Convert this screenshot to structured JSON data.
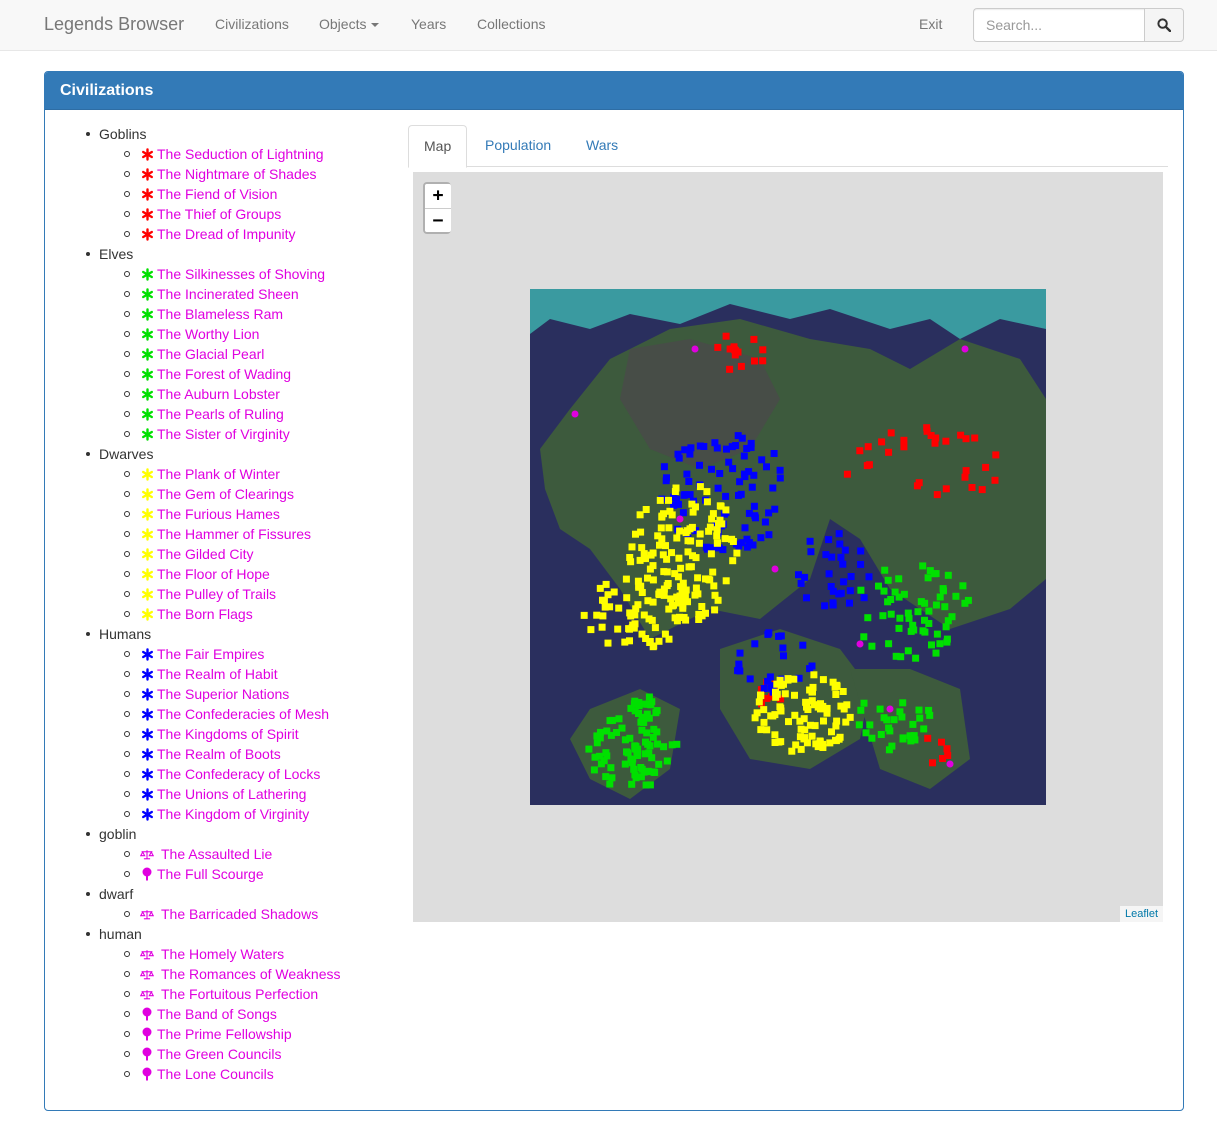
{
  "navbar": {
    "brand": "Legends Browser",
    "links": [
      "Civilizations",
      "Objects",
      "Years",
      "Collections"
    ],
    "exit": "Exit",
    "search_placeholder": "Search..."
  },
  "panel": {
    "title": "Civilizations"
  },
  "tabs": {
    "items": [
      "Map",
      "Population",
      "Wars"
    ],
    "active": "Map"
  },
  "map": {
    "zoom_in": "+",
    "zoom_out": "−",
    "attribution": "Leaflet"
  },
  "colors": {
    "link": "#e000e0",
    "panel": "#337ab7",
    "goblins": "#ff0000",
    "elves": "#00e000",
    "dwarves": "#ffff00",
    "humans": "#0000ff",
    "entity": "#e000e0",
    "ocean": "#2a2f5e",
    "ice": "#3a9aa0",
    "land": "#3d5a3d"
  },
  "groups": [
    {
      "name": "Goblins",
      "icon": "asterisk",
      "color": "#ff0000",
      "items": [
        "The Seduction of Lightning",
        "The Nightmare of Shades",
        "The Fiend of Vision",
        "The Thief of Groups",
        "The Dread of Impunity"
      ]
    },
    {
      "name": "Elves",
      "icon": "asterisk",
      "color": "#00e000",
      "items": [
        "The Silkinesses of Shoving",
        "The Incinerated Sheen",
        "The Blameless Ram",
        "The Worthy Lion",
        "The Glacial Pearl",
        "The Forest of Wading",
        "The Auburn Lobster",
        "The Pearls of Ruling",
        "The Sister of Virginity"
      ]
    },
    {
      "name": "Dwarves",
      "icon": "asterisk",
      "color": "#ffff00",
      "items": [
        "The Plank of Winter",
        "The Gem of Clearings",
        "The Furious Hames",
        "The Hammer of Fissures",
        "The Gilded City",
        "The Floor of Hope",
        "The Pulley of Trails",
        "The Born Flags"
      ]
    },
    {
      "name": "Humans",
      "icon": "asterisk",
      "color": "#0000ff",
      "items": [
        "The Fair Empires",
        "The Realm of Habit",
        "The Superior Nations",
        "The Confederacies of Mesh",
        "The Kingdoms of Spirit",
        "The Realm of Boots",
        "The Confederacy of Locks",
        "The Unions of Lathering",
        "The Kingdom of Virginity"
      ]
    },
    {
      "name": "goblin",
      "icon": "mixed",
      "color": "#e000e0",
      "items": [
        "The Assaulted Lie",
        "The Full Scourge"
      ],
      "icons": [
        "scale",
        "tree"
      ]
    },
    {
      "name": "dwarf",
      "icon": "mixed",
      "color": "#e000e0",
      "items": [
        "The Barricaded Shadows"
      ],
      "icons": [
        "scale"
      ]
    },
    {
      "name": "human",
      "icon": "mixed",
      "color": "#e000e0",
      "items": [
        "The Homely Waters",
        "The Romances of Weakness",
        "The Fortuitous Perfection",
        "The Band of Songs",
        "The Prime Fellowship",
        "The Green Councils",
        "The Lone Councils"
      ],
      "icons": [
        "scale",
        "scale",
        "scale",
        "tree",
        "tree",
        "tree",
        "tree"
      ]
    }
  ]
}
